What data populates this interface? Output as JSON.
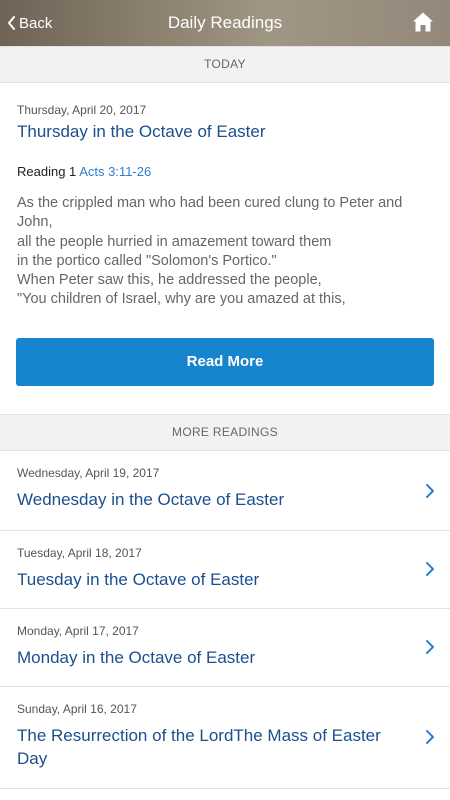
{
  "navbar": {
    "back_label": "Back",
    "title": "Daily Readings",
    "home_icon": "home-icon"
  },
  "today": {
    "section_label": "TODAY",
    "date": "Thursday, April 20, 2017",
    "title": "Thursday in the Octave of Easter",
    "reading_label": "Reading 1",
    "reading_ref": "Acts 3:11-26",
    "excerpt_lines": [
      "As the crippled man who had been cured clung to Peter and",
      "John,",
      "all the people hurried in amazement toward them",
      "in the portico called \"Solomon's Portico.\"",
      "When Peter saw this, he addressed the people,",
      "\"You children of Israel, why are you amazed at this,"
    ],
    "read_more_label": "Read More"
  },
  "more": {
    "section_label": "MORE READINGS",
    "items": [
      {
        "date": "Wednesday, April 19, 2017",
        "title": "Wednesday in the Octave of Easter"
      },
      {
        "date": "Tuesday, April 18, 2017",
        "title": "Tuesday in the Octave of Easter"
      },
      {
        "date": "Monday, April 17, 2017",
        "title": "Monday in the Octave of Easter"
      },
      {
        "date": "Sunday, April 16, 2017",
        "title": "The Resurrection of the LordThe Mass of Easter Day"
      }
    ]
  },
  "colors": {
    "link": "#1b4f8f",
    "button": "#1684cf",
    "chevron": "#2e7ecf"
  }
}
